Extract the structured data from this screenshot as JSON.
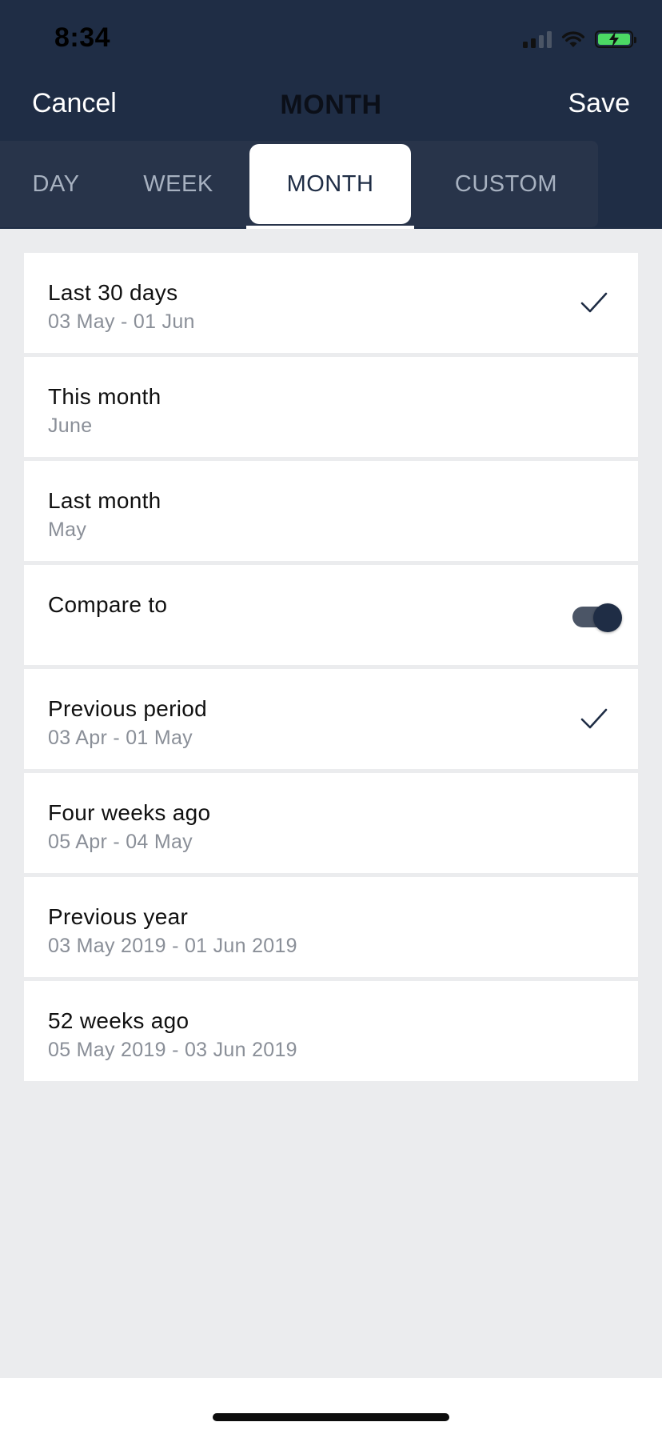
{
  "status": {
    "time": "8:34"
  },
  "nav": {
    "cancel": "Cancel",
    "title": "MONTH",
    "save": "Save"
  },
  "tabs": [
    {
      "label": "DAY",
      "active": false
    },
    {
      "label": "WEEK",
      "active": false
    },
    {
      "label": "MONTH",
      "active": true
    },
    {
      "label": "CUSTOM",
      "active": false
    }
  ],
  "rows": [
    {
      "title": "Last 30 days",
      "subtitle": "03 May - 01 Jun",
      "checked": true
    },
    {
      "title": "This month",
      "subtitle": "June",
      "checked": false
    },
    {
      "title": "Last month",
      "subtitle": "May",
      "checked": false
    },
    {
      "title": "Compare to",
      "subtitle": "",
      "toggle_on": true
    },
    {
      "title": "Previous period",
      "subtitle": "03 Apr - 01 May",
      "checked": true
    },
    {
      "title": "Four weeks ago",
      "subtitle": "05 Apr - 04 May",
      "checked": false
    },
    {
      "title": "Previous year",
      "subtitle": "03 May 2019 - 01 Jun 2019",
      "checked": false
    },
    {
      "title": "52 weeks ago",
      "subtitle": "05 May 2019 - 03 Jun 2019",
      "checked": false
    }
  ],
  "colors": {
    "header_bg": "#1f2d45",
    "tab_bar_bg": "#28344a",
    "page_bg": "#ebecee",
    "battery_green": "#4cd964"
  }
}
